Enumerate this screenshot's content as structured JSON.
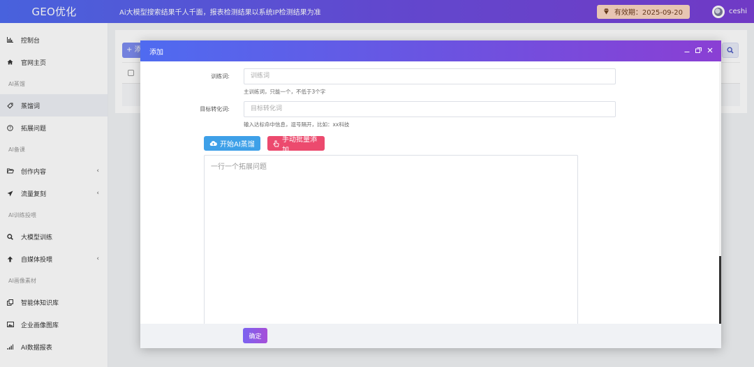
{
  "topbar": {
    "brand": "GEO优化",
    "slogan": "Ai大模型搜索结果千人千面，报表检测结果以系统IP检测结果为准",
    "validity_label": "有效期：2025-09-20",
    "username": "ceshi"
  },
  "sidebar": {
    "items": [
      {
        "type": "item",
        "icon": "bar-chart-icon",
        "label": "控制台"
      },
      {
        "type": "item",
        "icon": "home-icon",
        "label": "官网主页"
      },
      {
        "type": "group",
        "label": "AI蒸馏"
      },
      {
        "type": "item",
        "icon": "tag-icon",
        "label": "蒸馏词",
        "active": true
      },
      {
        "type": "item",
        "icon": "question-circle-icon",
        "label": "拓展问题"
      },
      {
        "type": "group",
        "label": "AI备课"
      },
      {
        "type": "item",
        "icon": "folder-open-icon",
        "label": "创作内容",
        "chevron": true
      },
      {
        "type": "item",
        "icon": "paper-plane-icon",
        "label": "流量复刻",
        "chevron": true
      },
      {
        "type": "group",
        "label": "AI训练投喂"
      },
      {
        "type": "item",
        "icon": "search-icon",
        "label": "大模型训练"
      },
      {
        "type": "item",
        "icon": "arrow-up-icon",
        "label": "自媒体投喂",
        "chevron": true
      },
      {
        "type": "group",
        "label": "AI画像素材"
      },
      {
        "type": "item",
        "icon": "clone-icon",
        "label": "智能体知识库"
      },
      {
        "type": "item",
        "icon": "image-icon",
        "label": "企业画像图库"
      },
      {
        "type": "item",
        "icon": "signal-icon",
        "label": "AI数据报表"
      }
    ]
  },
  "background": {
    "add_button": "+ 添"
  },
  "modal": {
    "title": "添加",
    "fields": {
      "train_word": {
        "label": "训练词:",
        "placeholder": "训练词",
        "hint": "主训练词，只能一个，不低于3个字"
      },
      "target_word": {
        "label": "目标转化词:",
        "placeholder": "目标转化词",
        "hint": "输入达标命中信息，逗号隔开，比如：xx科技"
      }
    },
    "buttons": {
      "ai_distill": "开始AI蒸馏",
      "bulk_add": "手动批量添加"
    },
    "textarea_placeholder": "一行一个拓展问题",
    "confirm": "确定"
  }
}
